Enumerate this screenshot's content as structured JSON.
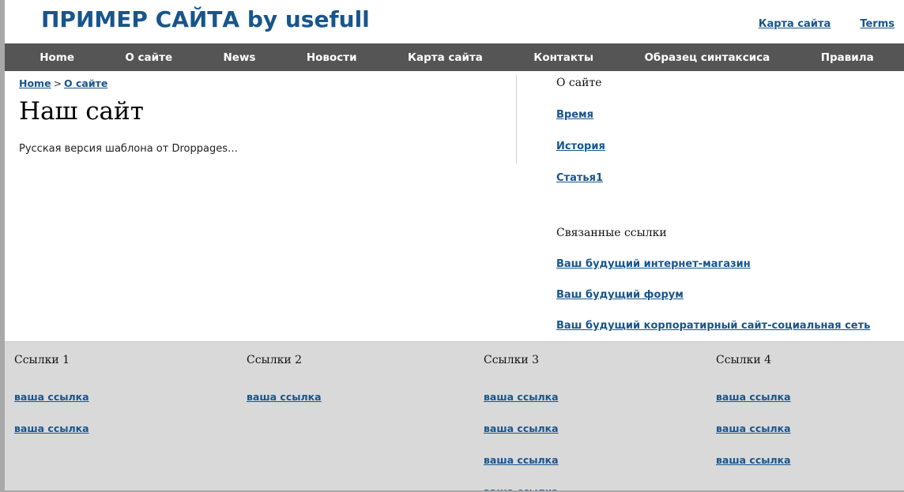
{
  "header": {
    "site_title": "ПРИМЕР САЙТА by usefull",
    "links": [
      {
        "label": "Карта сайта"
      },
      {
        "label": "Terms"
      }
    ]
  },
  "nav": {
    "items": [
      {
        "label": "Home"
      },
      {
        "label": "О сайте"
      },
      {
        "label": "News"
      },
      {
        "label": "Новости"
      },
      {
        "label": "Карта сайта"
      },
      {
        "label": "Контакты"
      },
      {
        "label": "Образец синтаксиса"
      },
      {
        "label": "Правила"
      }
    ]
  },
  "breadcrumb": {
    "home": "Home",
    "separator": ">",
    "current": "О сайте"
  },
  "main": {
    "heading": "Наш сайт",
    "intro": "Русская версия шаблона от Droppages…"
  },
  "sidebar": {
    "block1": {
      "heading": "О сайте",
      "links": [
        {
          "label": "Время"
        },
        {
          "label": "История"
        },
        {
          "label": "Статья1"
        }
      ]
    },
    "block2": {
      "heading": "Связанные ссылки",
      "links": [
        {
          "label": "Ваш будущий интернет-магазин"
        },
        {
          "label": "Ваш будущий форум"
        },
        {
          "label": "Ваш будущий корпоратирный сайт-социальная сеть"
        }
      ]
    }
  },
  "footer": {
    "columns": [
      {
        "heading": "Ссылки 1",
        "links": [
          {
            "label": "ваша ссылка"
          },
          {
            "label": "ваша ссылка"
          }
        ]
      },
      {
        "heading": "Ссылки 2",
        "links": [
          {
            "label": "ваша ссылка"
          }
        ]
      },
      {
        "heading": "Ссылки 3",
        "links": [
          {
            "label": "ваша ссылка"
          },
          {
            "label": "ваша ссылка"
          },
          {
            "label": "ваша ссылка"
          },
          {
            "label": "ваша ссылка"
          }
        ]
      },
      {
        "heading": "Ссылки 4",
        "links": [
          {
            "label": "ваша ссылка"
          },
          {
            "label": "ваша ссылка"
          },
          {
            "label": "ваша ссылка"
          }
        ]
      }
    ]
  },
  "colors": {
    "link": "#18558c",
    "nav_background": "#555555",
    "footer_background": "#d9d9d9",
    "page_border": "#a8a8a8"
  }
}
